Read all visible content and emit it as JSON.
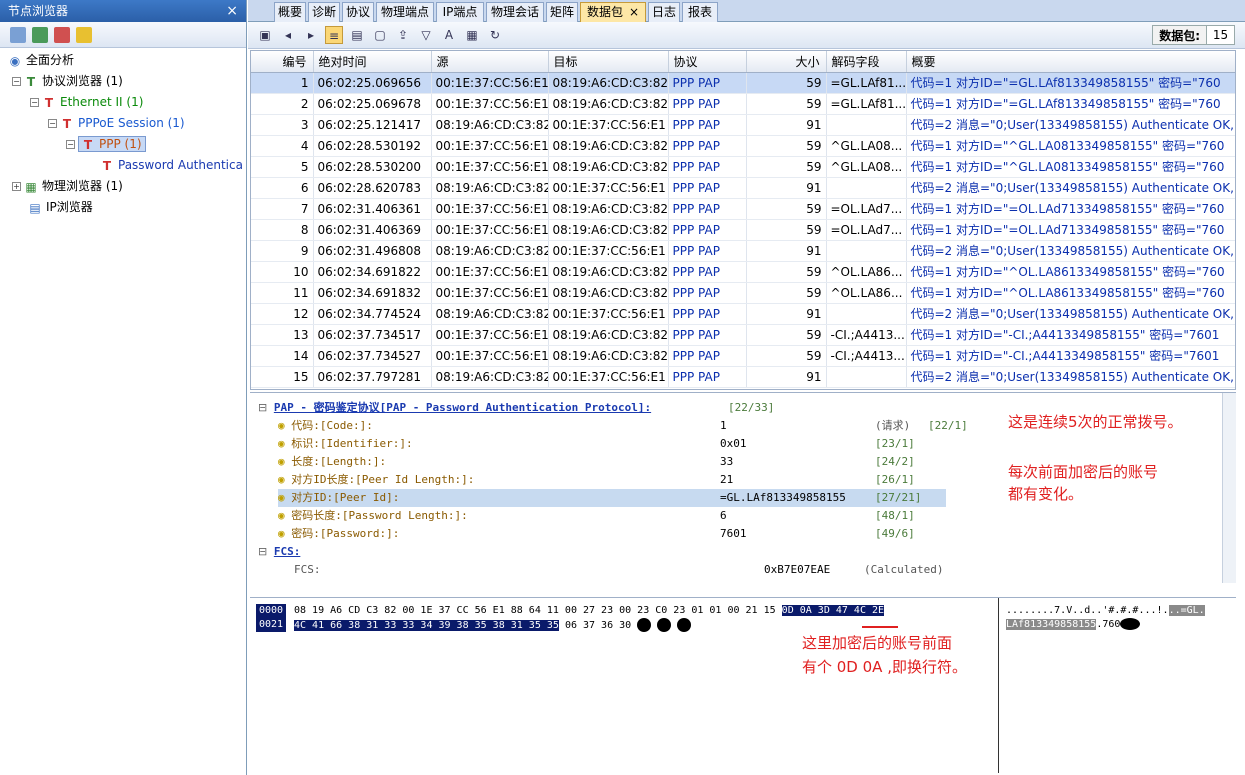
{
  "left_panel": {
    "title": "节点浏览器",
    "close": "×",
    "tree": [
      {
        "label": "全面分析"
      },
      {
        "label": "协议浏览器 (1)"
      },
      {
        "label": "Ethernet II (1)"
      },
      {
        "label": "PPPoE Session (1)"
      },
      {
        "label": "PPP (1)"
      },
      {
        "label": "Password Authentica"
      },
      {
        "label": "物理浏览器 (1)"
      },
      {
        "label": "IP浏览器"
      }
    ]
  },
  "tabs": [
    "概要",
    "诊断",
    "协议",
    "物理端点",
    "IP端点",
    "物理会话",
    "矩阵",
    "数据包",
    "日志",
    "报表"
  ],
  "active_tab": "数据包",
  "toolbar": {
    "packet_label": "数据包:",
    "packet_count": "15"
  },
  "columns": [
    "编号",
    "绝对时间",
    "源",
    "目标",
    "协议",
    "大小",
    "解码字段",
    "概要"
  ],
  "rows": [
    [
      "1",
      "06:02:25.069656",
      "00:1E:37:CC:56:E1",
      "08:19:A6:CD:C3:82",
      "PPP PAP",
      "59",
      "=GL.LAf81...",
      "代码=1 对方ID=\"=GL.LAf813349858155\" 密码=\"760"
    ],
    [
      "2",
      "06:02:25.069678",
      "00:1E:37:CC:56:E1",
      "08:19:A6:CD:C3:82",
      "PPP PAP",
      "59",
      "=GL.LAf81...",
      "代码=1 对方ID=\"=GL.LAf813349858155\" 密码=\"760"
    ],
    [
      "3",
      "06:02:25.121417",
      "08:19:A6:CD:C3:82",
      "00:1E:37:CC:56:E1",
      "PPP PAP",
      "91",
      "",
      "代码=2 消息=\"0;User(13349858155) Authenticate OK,..."
    ],
    [
      "4",
      "06:02:28.530192",
      "00:1E:37:CC:56:E1",
      "08:19:A6:CD:C3:82",
      "PPP PAP",
      "59",
      "^GL.LA08...",
      "代码=1 对方ID=\"^GL.LA0813349858155\" 密码=\"760"
    ],
    [
      "5",
      "06:02:28.530200",
      "00:1E:37:CC:56:E1",
      "08:19:A6:CD:C3:82",
      "PPP PAP",
      "59",
      "^GL.LA08...",
      "代码=1 对方ID=\"^GL.LA0813349858155\" 密码=\"760"
    ],
    [
      "6",
      "06:02:28.620783",
      "08:19:A6:CD:C3:82",
      "00:1E:37:CC:56:E1",
      "PPP PAP",
      "91",
      "",
      "代码=2 消息=\"0;User(13349858155) Authenticate OK,..."
    ],
    [
      "7",
      "06:02:31.406361",
      "00:1E:37:CC:56:E1",
      "08:19:A6:CD:C3:82",
      "PPP PAP",
      "59",
      "=OL.LAd7...",
      "代码=1 对方ID=\"=OL.LAd713349858155\" 密码=\"760"
    ],
    [
      "8",
      "06:02:31.406369",
      "00:1E:37:CC:56:E1",
      "08:19:A6:CD:C3:82",
      "PPP PAP",
      "59",
      "=OL.LAd7...",
      "代码=1 对方ID=\"=OL.LAd713349858155\" 密码=\"760"
    ],
    [
      "9",
      "06:02:31.496808",
      "08:19:A6:CD:C3:82",
      "00:1E:37:CC:56:E1",
      "PPP PAP",
      "91",
      "",
      "代码=2 消息=\"0;User(13349858155) Authenticate OK,..."
    ],
    [
      "10",
      "06:02:34.691822",
      "00:1E:37:CC:56:E1",
      "08:19:A6:CD:C3:82",
      "PPP PAP",
      "59",
      "^OL.LA86...",
      "代码=1 对方ID=\"^OL.LA8613349858155\" 密码=\"760"
    ],
    [
      "11",
      "06:02:34.691832",
      "00:1E:37:CC:56:E1",
      "08:19:A6:CD:C3:82",
      "PPP PAP",
      "59",
      "^OL.LA86...",
      "代码=1 对方ID=\"^OL.LA8613349858155\" 密码=\"760"
    ],
    [
      "12",
      "06:02:34.774524",
      "08:19:A6:CD:C3:82",
      "00:1E:37:CC:56:E1",
      "PPP PAP",
      "91",
      "",
      "代码=2 消息=\"0;User(13349858155) Authenticate OK,..."
    ],
    [
      "13",
      "06:02:37.734517",
      "00:1E:37:CC:56:E1",
      "08:19:A6:CD:C3:82",
      "PPP PAP",
      "59",
      "-CI.;A4413...",
      "代码=1 对方ID=\"-CI.;A4413349858155\" 密码=\"7601"
    ],
    [
      "14",
      "06:02:37.734527",
      "00:1E:37:CC:56:E1",
      "08:19:A6:CD:C3:82",
      "PPP PAP",
      "59",
      "-CI.;A4413...",
      "代码=1 对方ID=\"-CI.;A4413349858155\" 密码=\"7601"
    ],
    [
      "15",
      "06:02:37.797281",
      "08:19:A6:CD:C3:82",
      "00:1E:37:CC:56:E1",
      "PPP PAP",
      "91",
      "",
      "代码=2 消息=\"0;User(13349858155) Authenticate OK,..."
    ]
  ],
  "detail": {
    "header": "PAP - 密码鉴定协议[PAP - Password Authentication Protocol]:",
    "header_offset": "[22/33]",
    "fields": [
      {
        "key": "代码:[Code:]:",
        "value": "1",
        "extra": "(请求)",
        "offset": "[22/1]"
      },
      {
        "key": "标识:[Identifier:]:",
        "value": "0x01",
        "extra": "",
        "offset": "[23/1]"
      },
      {
        "key": "长度:[Length:]:",
        "value": "33",
        "extra": "",
        "offset": "[24/2]"
      },
      {
        "key": "对方ID长度:[Peer Id Length:]:",
        "value": "21",
        "extra": "",
        "offset": "[26/1]"
      },
      {
        "key": "对方ID:[Peer Id]:",
        "value": "=GL.LAf813349858155",
        "extra": "",
        "offset": "[27/21]"
      },
      {
        "key": "密码长度:[Password Length:]:",
        "value": "6",
        "extra": "",
        "offset": "[48/1]"
      },
      {
        "key": "密码:[Password:]:",
        "value": "7601",
        "extra": "",
        "offset": "[49/6]"
      }
    ],
    "fcs_label": "FCS:",
    "fcs_key": "FCS:",
    "fcs_value": "0xB7E07EAE",
    "fcs_note": "(Calculated)"
  },
  "hex": {
    "offsets": [
      "0000",
      "0021"
    ],
    "line1_plain": "08 19 A6 CD C3 82 00 1E 37 CC 56 E1 88 64 11 00 27 23 00 23 C0 23 01 01 00 21 15",
    "line1_hl": "0D 0A 3D 47 4C 2E",
    "line2_hl": "4C 41 66 38 31 33 33 34 39 38 35 38 31 35 35",
    "line2_plain": "06 37 36 30",
    "ascii1_plain": "........7.V..d..'#.#.#...!.",
    "ascii1_hl": "..=GL.",
    "ascii2_hl": "LAf813349858155",
    "ascii2_plain": ".760"
  },
  "annotations": {
    "a1": "这是连续5次的正常拨号。",
    "a2_line1": "每次前面加密后的账号",
    "a2_line2": "都有变化。",
    "a3_line1": "这里加密后的账号前面",
    "a3_line2": "有个 0D 0A ,即换行符。"
  }
}
